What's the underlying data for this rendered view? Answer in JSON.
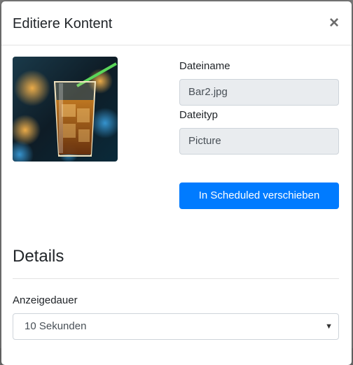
{
  "modal": {
    "title": "Editiere Kontent",
    "close_symbol": "×",
    "close_icon": "close-icon"
  },
  "content": {
    "filename_label": "Dateiname",
    "filename_value": "Bar2.jpg",
    "filetype_label": "Dateityp",
    "filetype_value": "Picture",
    "move_button_label": "In Scheduled verschieben",
    "thumbnail_description": "glass-of-drink-image"
  },
  "details": {
    "title": "Details",
    "duration_label": "Anzeigedauer",
    "duration_selected": "10 Sekunden"
  },
  "colors": {
    "primary": "#007bff",
    "input_disabled_bg": "#e9ecef",
    "text": "#212529"
  }
}
